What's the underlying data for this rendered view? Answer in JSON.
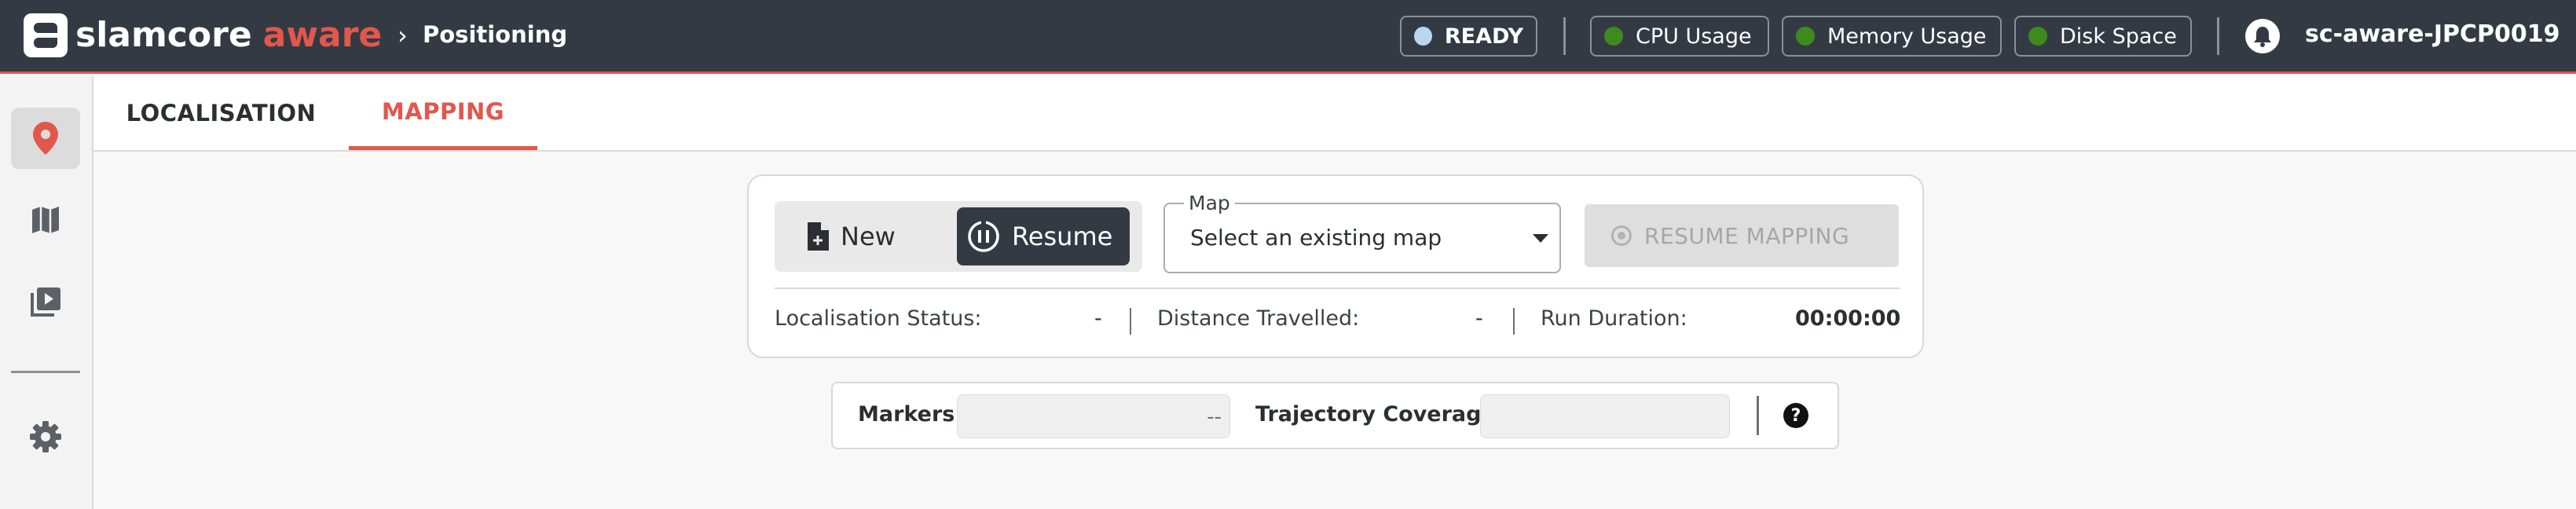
{
  "app": {
    "brand_primary": "slamcore",
    "brand_secondary": "aware",
    "breadcrumb_separator": "›",
    "breadcrumb": "Positioning",
    "accent_color": "#e2574c",
    "topbar_color": "#343a43"
  },
  "status": {
    "ready_label": "READY",
    "indicators": [
      {
        "label": "CPU Usage",
        "color": "#3d8b1e"
      },
      {
        "label": "Memory Usage",
        "color": "#3d8b1e"
      },
      {
        "label": "Disk Space",
        "color": "#3d8b1e"
      }
    ],
    "device_name": "sc-aware-JPCP0019"
  },
  "sidebar": {
    "items": [
      {
        "name": "location-pin-icon",
        "active": true
      },
      {
        "name": "map-icon",
        "active": false
      },
      {
        "name": "video-library-icon",
        "active": false
      },
      {
        "name": "gear-icon",
        "active": false
      }
    ]
  },
  "tabs": [
    {
      "label": "LOCALISATION",
      "active": false
    },
    {
      "label": "MAPPING",
      "active": true
    }
  ],
  "mapping": {
    "mode_new": "New",
    "mode_resume": "Resume",
    "selected_mode": "Resume",
    "map_legend": "Map",
    "map_value": "Select an existing map",
    "resume_button": "RESUME MAPPING",
    "resume_enabled": false
  },
  "stats": {
    "localisation_label": "Localisation Status:",
    "localisation_value": "-",
    "distance_label": "Distance Travelled:",
    "distance_value": "-",
    "duration_label": "Run Duration:",
    "duration_value": "00:00:00"
  },
  "markers": {
    "markers_label": "Markers:",
    "markers_value": "--",
    "trajectory_label": "Trajectory Coverage:",
    "trajectory_value": "",
    "help_symbol": "?"
  }
}
